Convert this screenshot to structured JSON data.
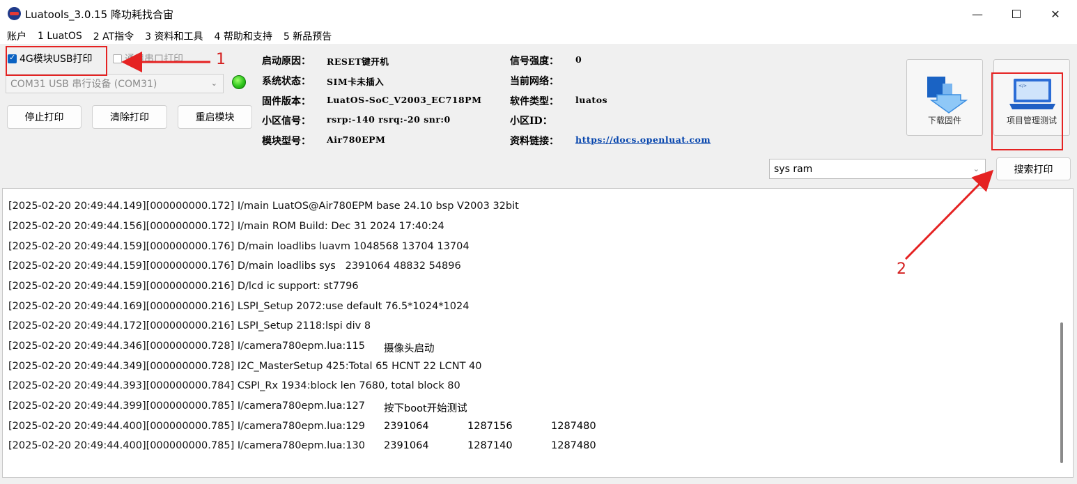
{
  "window": {
    "title": "Luatools_3.0.15 降功耗找合宙"
  },
  "menu": [
    "账户",
    "1 LuatOS",
    "2 AT指令",
    "3 资料和工具",
    "4 帮助和支持",
    "5 新品预告"
  ],
  "controls": {
    "usb_print_label": "4G模块USB打印",
    "usb_print_checked": true,
    "serial_print_label": "通用串口打印",
    "port_value": "COM31 USB 串行设备 (COM31)",
    "stop_print": "停止打印",
    "clear_print": "清除打印",
    "restart_module": "重启模块"
  },
  "info": {
    "boot_reason_label": "启动原因：",
    "boot_reason": "RESET键开机",
    "system_state_label": "系统状态：",
    "system_state": "SIM卡未插入",
    "firmware_label": "固件版本：",
    "firmware": "LuatOS-SoC_V2003_EC718PM",
    "cell_signal_label": "小区信号：",
    "cell_signal": "rsrp:-140 rsrq:-20 snr:0",
    "module_model_label": "模块型号：",
    "module_model": "Air780EPM",
    "signal_strength_label": "信号强度：",
    "signal_strength": "0",
    "network_label": "当前网络：",
    "network": "",
    "software_type_label": "软件类型：",
    "software_type": "luatos",
    "cell_id_label": "小区ID：",
    "cell_id": "",
    "docs_label": "资料链接：",
    "docs_link": "https://docs.openluat.com"
  },
  "actions": {
    "download_firmware": "下载固件",
    "project_test": "项目管理测试",
    "search_value": "sys ram",
    "search_print": "搜索打印"
  },
  "log": [
    {
      "main": "[2025-02-20 20:49:44.149][000000000.172] I/main LuatOS@Air780EPM base 24.10 bsp V2003 32bit"
    },
    {
      "main": "[2025-02-20 20:49:44.156][000000000.172] I/main ROM Build: Dec 31 2024 17:40:24"
    },
    {
      "main": "[2025-02-20 20:49:44.159][000000000.176] D/main loadlibs luavm 1048568 13704 13704"
    },
    {
      "main": "[2025-02-20 20:49:44.159][000000000.176] D/main loadlibs sys   2391064 48832 54896"
    },
    {
      "main": "[2025-02-20 20:49:44.159][000000000.216] D/lcd ic support: st7796"
    },
    {
      "main": "[2025-02-20 20:49:44.169][000000000.216] LSPI_Setup 2072:use default 76.5*1024*1024"
    },
    {
      "main": "[2025-02-20 20:49:44.172][000000000.216] LSPI_Setup 2118:lspi div 8"
    },
    {
      "main": "[2025-02-20 20:49:44.346][000000000.728] I/camera780epm.lua:115",
      "c1": "摄像头启动"
    },
    {
      "main": "[2025-02-20 20:49:44.349][000000000.728] I2C_MasterSetup 425:Total 65 HCNT 22 LCNT 40"
    },
    {
      "main": "[2025-02-20 20:49:44.393][000000000.784] CSPI_Rx 1934:block len 7680, total block 80"
    },
    {
      "main": "[2025-02-20 20:49:44.399][000000000.785] I/camera780epm.lua:127",
      "c1": "按下boot开始测试"
    },
    {
      "main": "[2025-02-20 20:49:44.400][000000000.785] I/camera780epm.lua:129",
      "c1": "2391064",
      "c2": "1287156",
      "c3": "1287480"
    },
    {
      "main": "[2025-02-20 20:49:44.400][000000000.785] I/camera780epm.lua:130",
      "c1": "2391064",
      "c2": "1287140",
      "c3": "1287480"
    }
  ],
  "annotations": {
    "one": "1",
    "two": "2",
    "color": "#e52222"
  }
}
